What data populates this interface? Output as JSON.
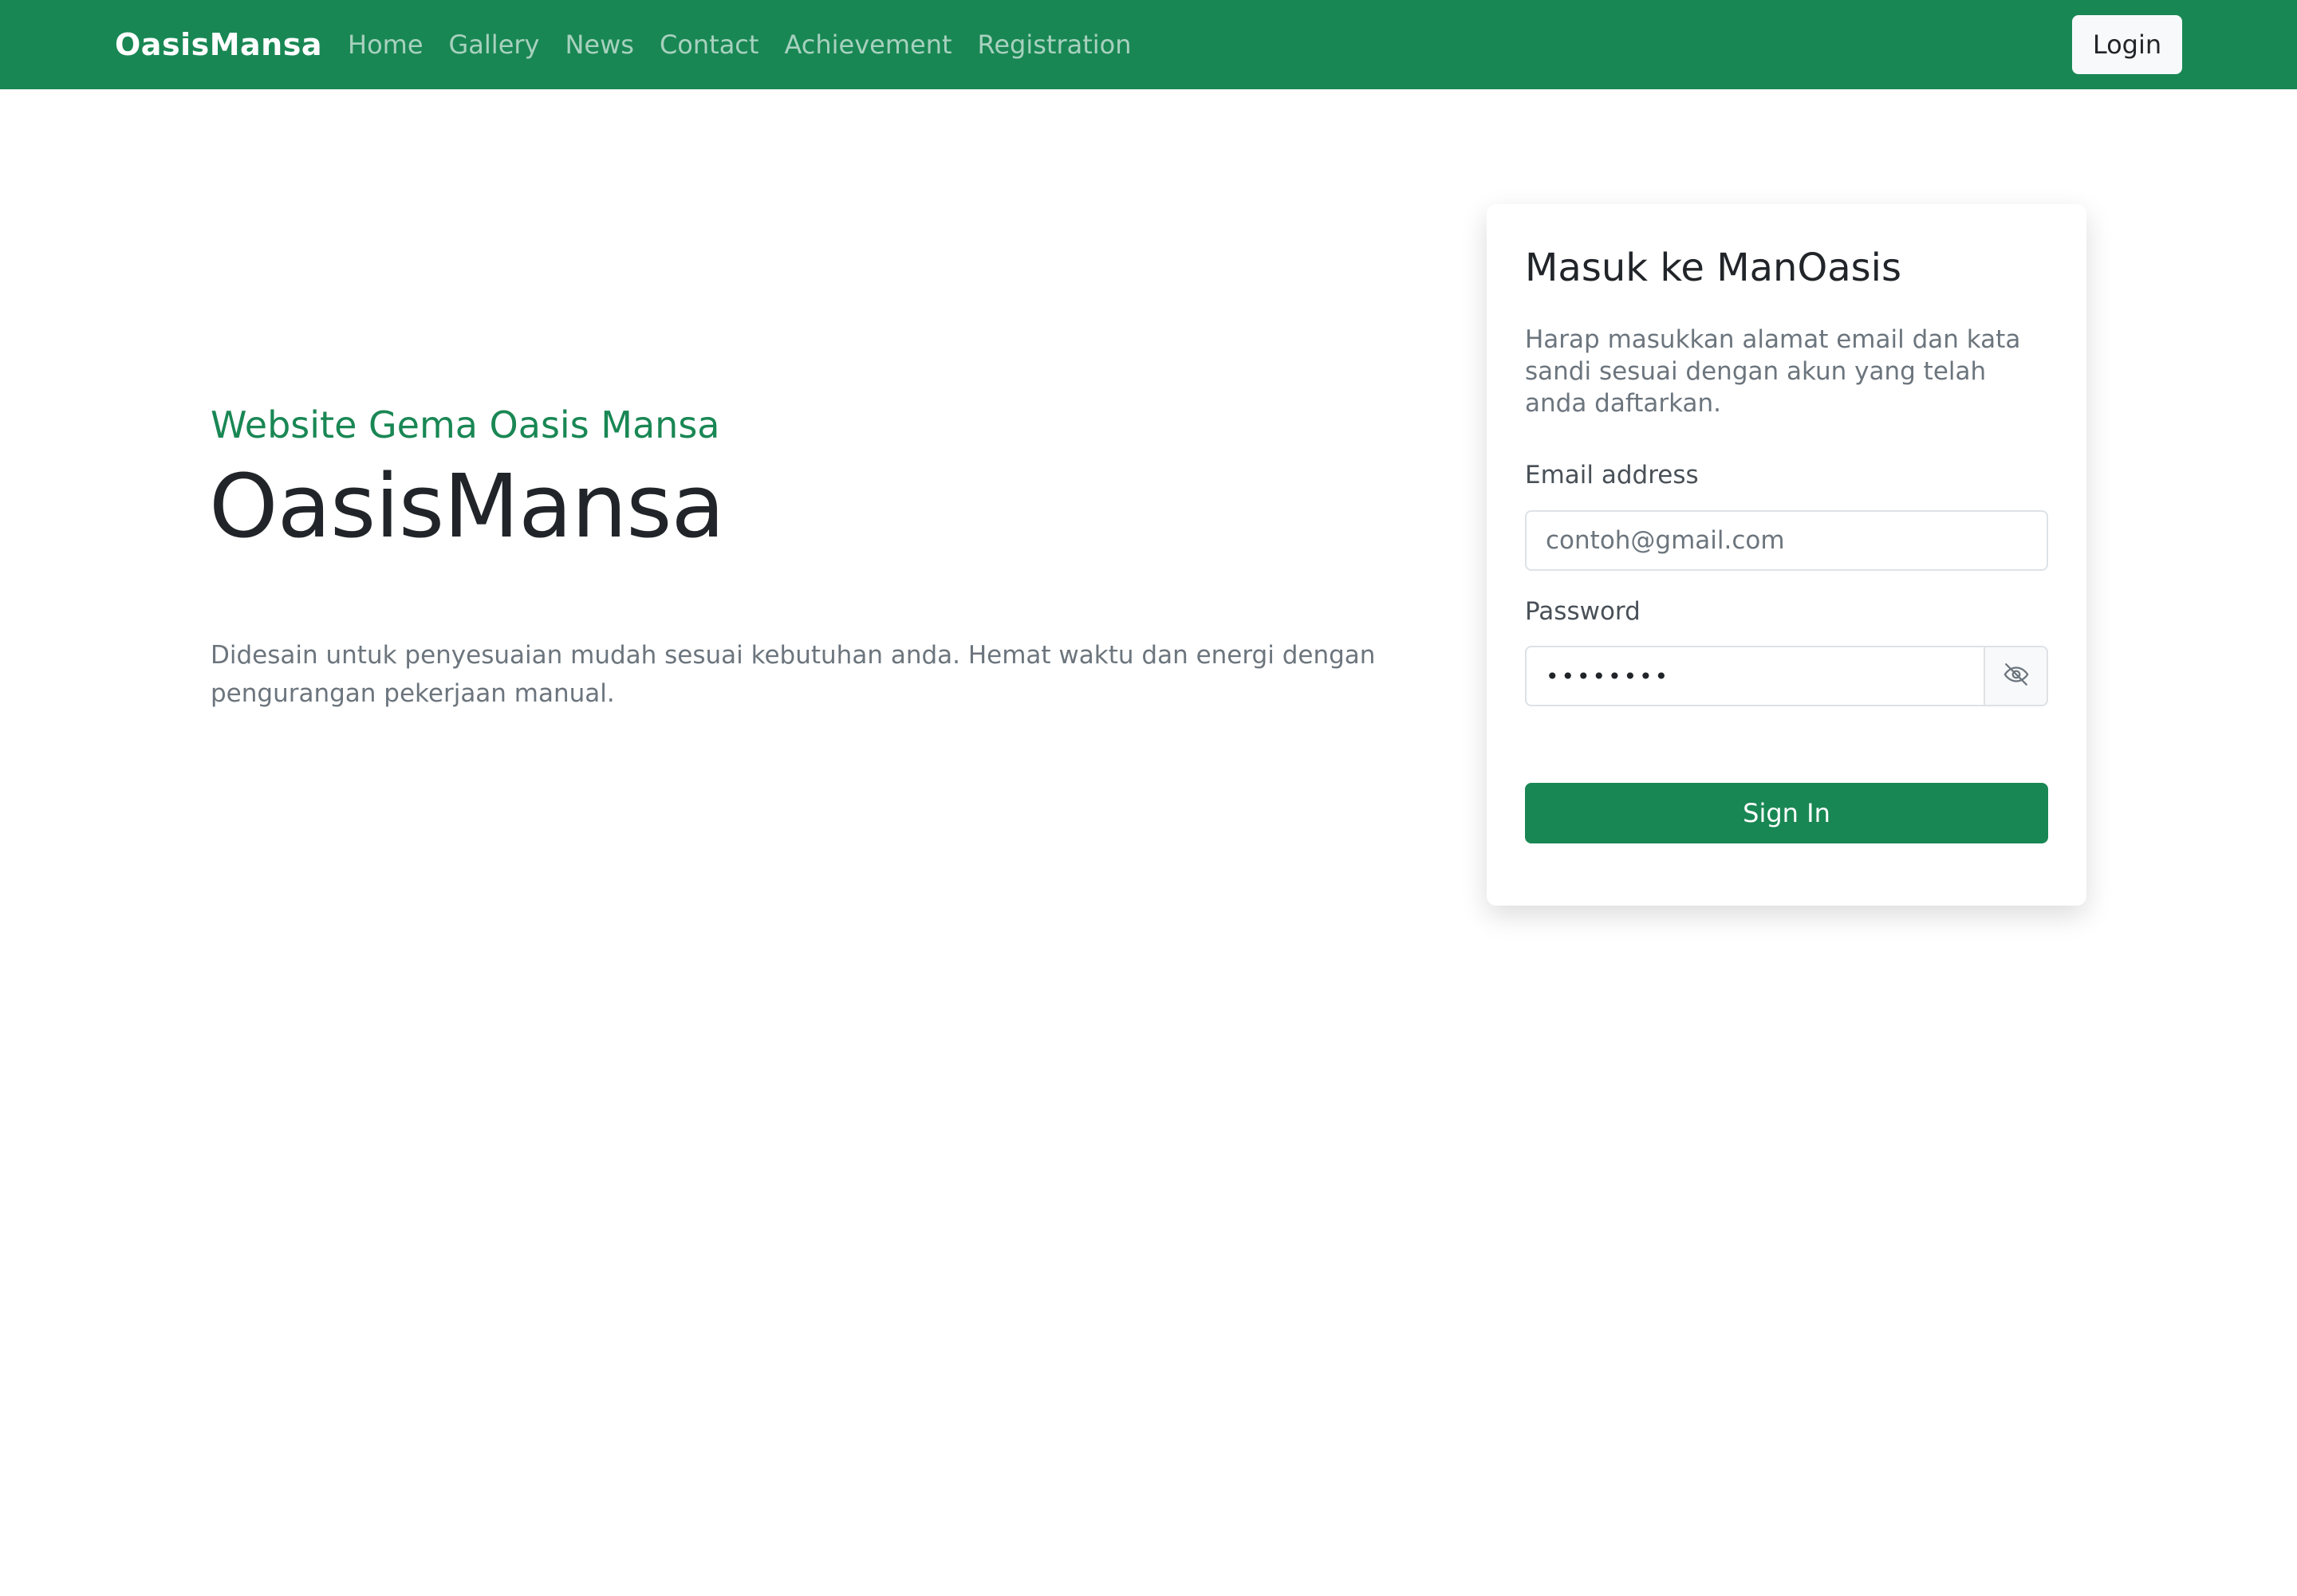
{
  "navbar": {
    "brand": "OasisMansa",
    "links": [
      "Home",
      "Gallery",
      "News",
      "Contact",
      "Achievement",
      "Registration"
    ],
    "login_label": "Login",
    "background_color": "#198754"
  },
  "hero": {
    "subtitle": "Website Gema Oasis Mansa",
    "title": "OasisMansa",
    "description": "Didesain untuk penyesuaian mudah sesuai kebutuhan anda. Hemat waktu dan energi dengan pengurangan pekerjaan manual."
  },
  "login_card": {
    "title": "Masuk ke ManOasis",
    "description": "Harap masukkan alamat email dan kata sandi sesuai dengan akun yang telah anda daftarkan.",
    "email_label": "Email address",
    "email_placeholder": "contoh@gmail.com",
    "password_label": "Password",
    "password_value_masked": "••••••••",
    "password_toggle_icon": "eye-slash-icon",
    "signin_label": "Sign In"
  },
  "colors": {
    "primary": "#198754",
    "text_dark": "#212529",
    "text_muted": "#6c757d"
  }
}
